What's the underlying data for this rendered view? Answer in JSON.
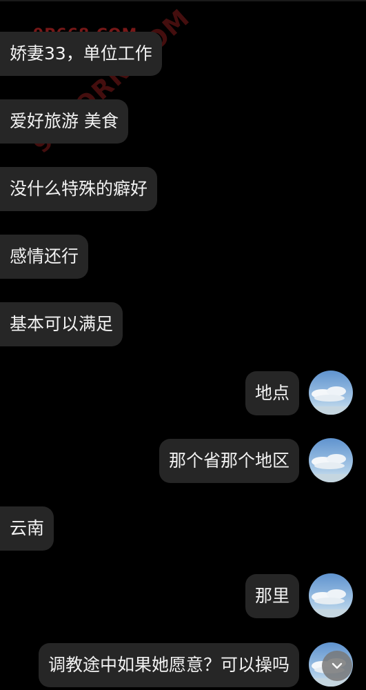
{
  "watermarks": {
    "top": "9P668.COM",
    "diagonal": "91PORN.COM"
  },
  "messages": [
    {
      "side": "left",
      "text": "娇妻33，单位工作"
    },
    {
      "side": "left",
      "text": "爱好旅游 美食"
    },
    {
      "side": "left",
      "text": "没什么特殊的癖好"
    },
    {
      "side": "left",
      "text": "感情还行"
    },
    {
      "side": "left",
      "text": "基本可以满足"
    },
    {
      "side": "right",
      "text": "地点"
    },
    {
      "side": "right",
      "text": "那个省那个地区"
    },
    {
      "side": "left",
      "text": "云南"
    },
    {
      "side": "right",
      "text": "那里"
    },
    {
      "side": "right",
      "text": "调教途中如果她愿意？可以操吗"
    }
  ],
  "icons": {
    "avatar": "sky-clouds-avatar",
    "scroll": "chevron-down-icon"
  },
  "colors": {
    "background": "#000000",
    "bubble": "#262626",
    "text": "#f2f2f2"
  }
}
